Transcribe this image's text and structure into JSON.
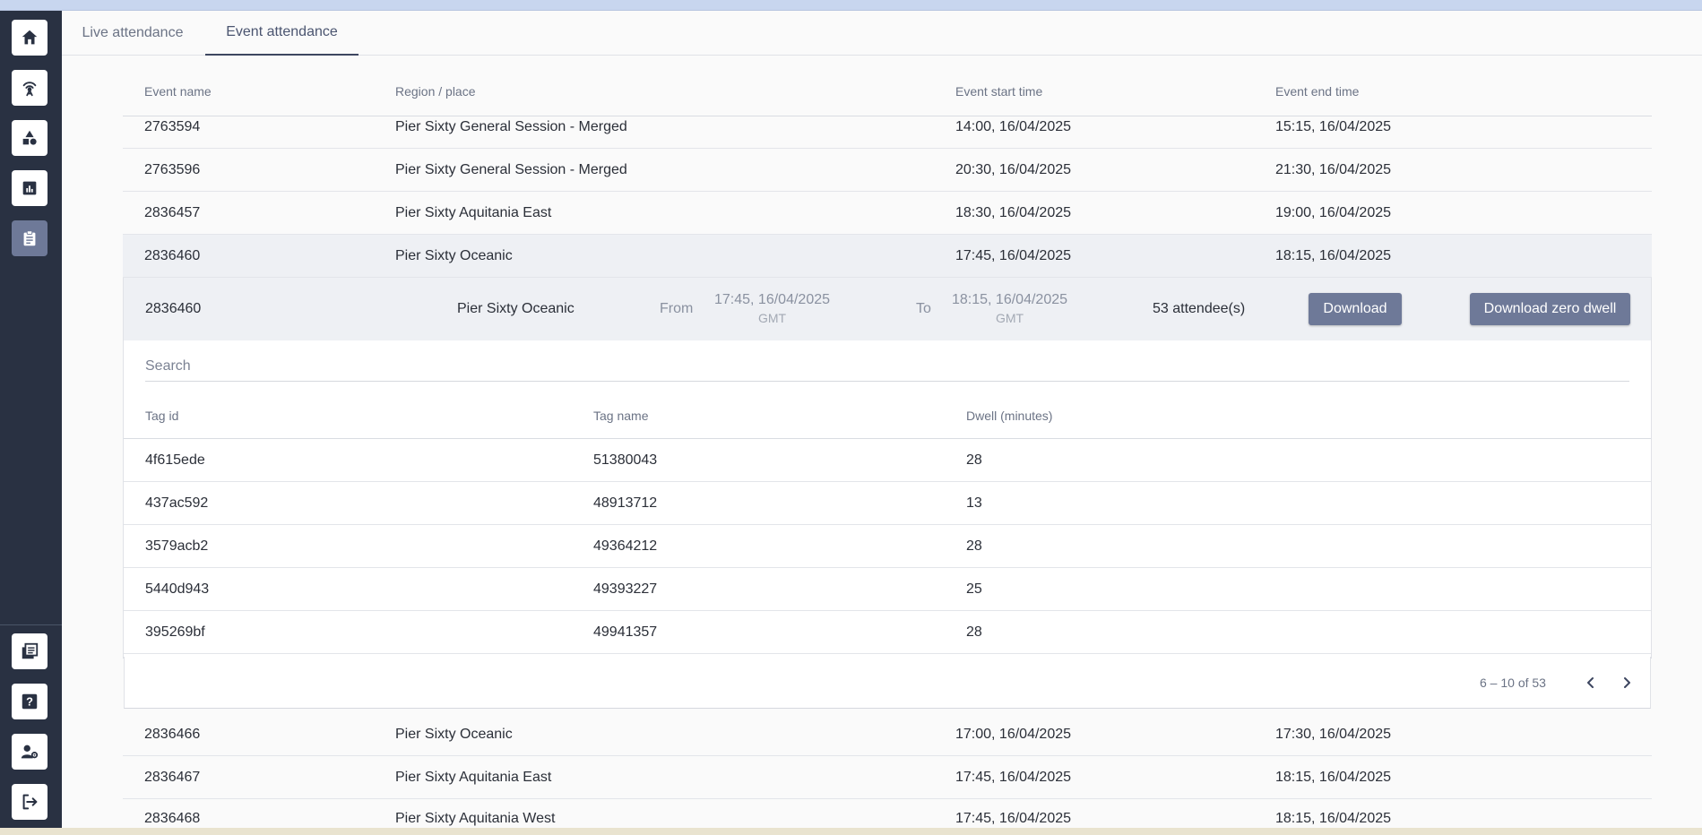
{
  "tabs": [
    {
      "label": "Live attendance",
      "active": false
    },
    {
      "label": "Event attendance",
      "active": true
    }
  ],
  "sidebar": {
    "top_items": [
      {
        "icon": "home-icon"
      },
      {
        "icon": "antenna-icon"
      },
      {
        "icon": "shapes-icon"
      },
      {
        "icon": "chart-icon"
      },
      {
        "icon": "clipboard-icon",
        "active": true
      }
    ],
    "bottom_items": [
      {
        "icon": "library-icon"
      },
      {
        "icon": "help-icon"
      },
      {
        "icon": "user-settings-icon"
      },
      {
        "icon": "logout-icon"
      }
    ]
  },
  "events": {
    "headers": {
      "name": "Event name",
      "region": "Region / place",
      "start": "Event start time",
      "end": "Event end time"
    },
    "rows_before": [
      {
        "name": "2763594",
        "region": "Pier Sixty General Session - Merged",
        "start": "14:00, 16/04/2025",
        "end": "15:15, 16/04/2025"
      },
      {
        "name": "2763596",
        "region": "Pier Sixty General Session - Merged",
        "start": "20:30, 16/04/2025",
        "end": "21:30, 16/04/2025"
      },
      {
        "name": "2836457",
        "region": "Pier Sixty Aquitania East",
        "start": "18:30, 16/04/2025",
        "end": "19:00, 16/04/2025"
      },
      {
        "name": "2836460",
        "region": "Pier Sixty Oceanic",
        "start": "17:45, 16/04/2025",
        "end": "18:15, 16/04/2025"
      }
    ],
    "rows_after": [
      {
        "name": "2836466",
        "region": "Pier Sixty Oceanic",
        "start": "17:00, 16/04/2025",
        "end": "17:30, 16/04/2025"
      },
      {
        "name": "2836467",
        "region": "Pier Sixty Aquitania East",
        "start": "17:45, 16/04/2025",
        "end": "18:15, 16/04/2025"
      },
      {
        "name": "2836468",
        "region": "Pier Sixty Aquitania West",
        "start": "17:45, 16/04/2025",
        "end": "18:15, 16/04/2025"
      }
    ]
  },
  "detail": {
    "event_id": "2836460",
    "region": "Pier Sixty Oceanic",
    "from_label": "From",
    "from_time": "17:45, 16/04/2025",
    "from_tz": "GMT",
    "to_label": "To",
    "to_time": "18:15, 16/04/2025",
    "to_tz": "GMT",
    "attendees": "53 attendee(s)",
    "download_label": "Download",
    "download_zero_label": "Download zero dwell",
    "search_placeholder": "Search",
    "tag_headers": {
      "id": "Tag id",
      "name": "Tag name",
      "dwell": "Dwell (minutes)"
    },
    "tags": [
      {
        "id": "4f615ede",
        "name": "51380043",
        "dwell": "28"
      },
      {
        "id": "437ac592",
        "name": "48913712",
        "dwell": "13"
      },
      {
        "id": "3579acb2",
        "name": "49364212",
        "dwell": "28"
      },
      {
        "id": "5440d943",
        "name": "49393227",
        "dwell": "25"
      },
      {
        "id": "395269bf",
        "name": "49941357",
        "dwell": "28"
      }
    ],
    "pagination": "6 – 10 of 53"
  },
  "colors": {
    "sidebar": "#293142",
    "accent": "#6e7998",
    "selected_row": "#eef0f4"
  }
}
